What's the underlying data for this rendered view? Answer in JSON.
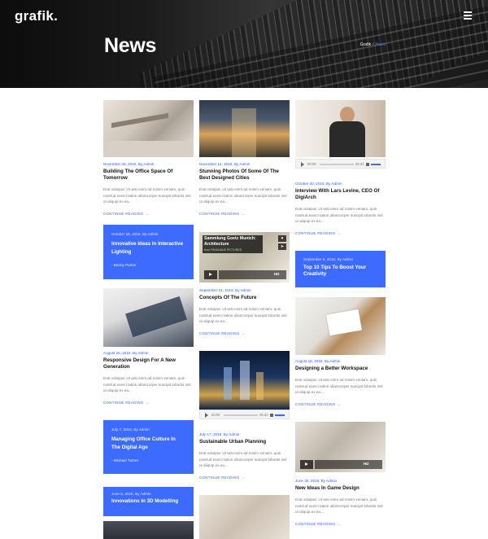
{
  "header": {
    "logo": "grafik.",
    "page_title": "News",
    "breadcrumb_home": "Grafik",
    "breadcrumb_sep": "/",
    "breadcrumb_current": "News"
  },
  "excerpt": "Erat volutpat. Ut wisi enim ad minim veniam, quis nostrud exerci tation ullamcorper suscipit lobortis nisl ut aliquip ex ea...",
  "more": "CONTINUE READING  →",
  "player": {
    "start": "00:00",
    "end": "06:22"
  },
  "video1": {
    "title": "Sammlung Goetz Munich: Architecture",
    "from": "from PAVAHAUS PICTURES",
    "hd": "HD"
  },
  "video2": {
    "hd": "HD"
  },
  "quotes": [
    {
      "meta": "October 16, 2015,  By Admin",
      "title": "Innovative Ideas In Interactive Lighting",
      "author": "- Benny Parker"
    },
    {
      "meta": "September 5, 2015,  By Admin",
      "title": "Top 10 Tips To Boost Your Creativity"
    },
    {
      "meta": "July 7, 2015,  By Admin",
      "title": "Managing Office Culture In The Digital Age",
      "author": "- Michael Turner"
    },
    {
      "meta": "June 8, 2015,  By Admin",
      "title": "Innovations In 3D Modelling"
    }
  ],
  "posts": [
    {
      "meta": "November 25, 2015,  By Admin",
      "title": "Building The Office Space Of Tomorrow"
    },
    {
      "meta": "November 14, 2015,  By Admin",
      "title": "Stunning Photos Of Some Of The Best Designed Cities"
    },
    {
      "meta": "October 20, 2015,  By Admin",
      "title": "Interview With Lars Levine, CEO Of DigiArch"
    },
    {
      "meta": "September 21, 2015,  By Admin",
      "title": "Concepts Of The Future"
    },
    {
      "meta": "August 26, 2015,  By Admin",
      "title": "Responsive Design For A New Generation"
    },
    {
      "meta": "August 16, 2015,  By Admin",
      "title": "Designing a Better Workspace"
    },
    {
      "meta": "July 17, 2015,  By Admin",
      "title": "Sustainable Urban Planning"
    },
    {
      "meta": "June 30, 2015,  By Admin",
      "title": "New Ideas In Game Design"
    }
  ],
  "colors": {
    "accent": "#3e6bff",
    "link": "#2f5bff"
  }
}
